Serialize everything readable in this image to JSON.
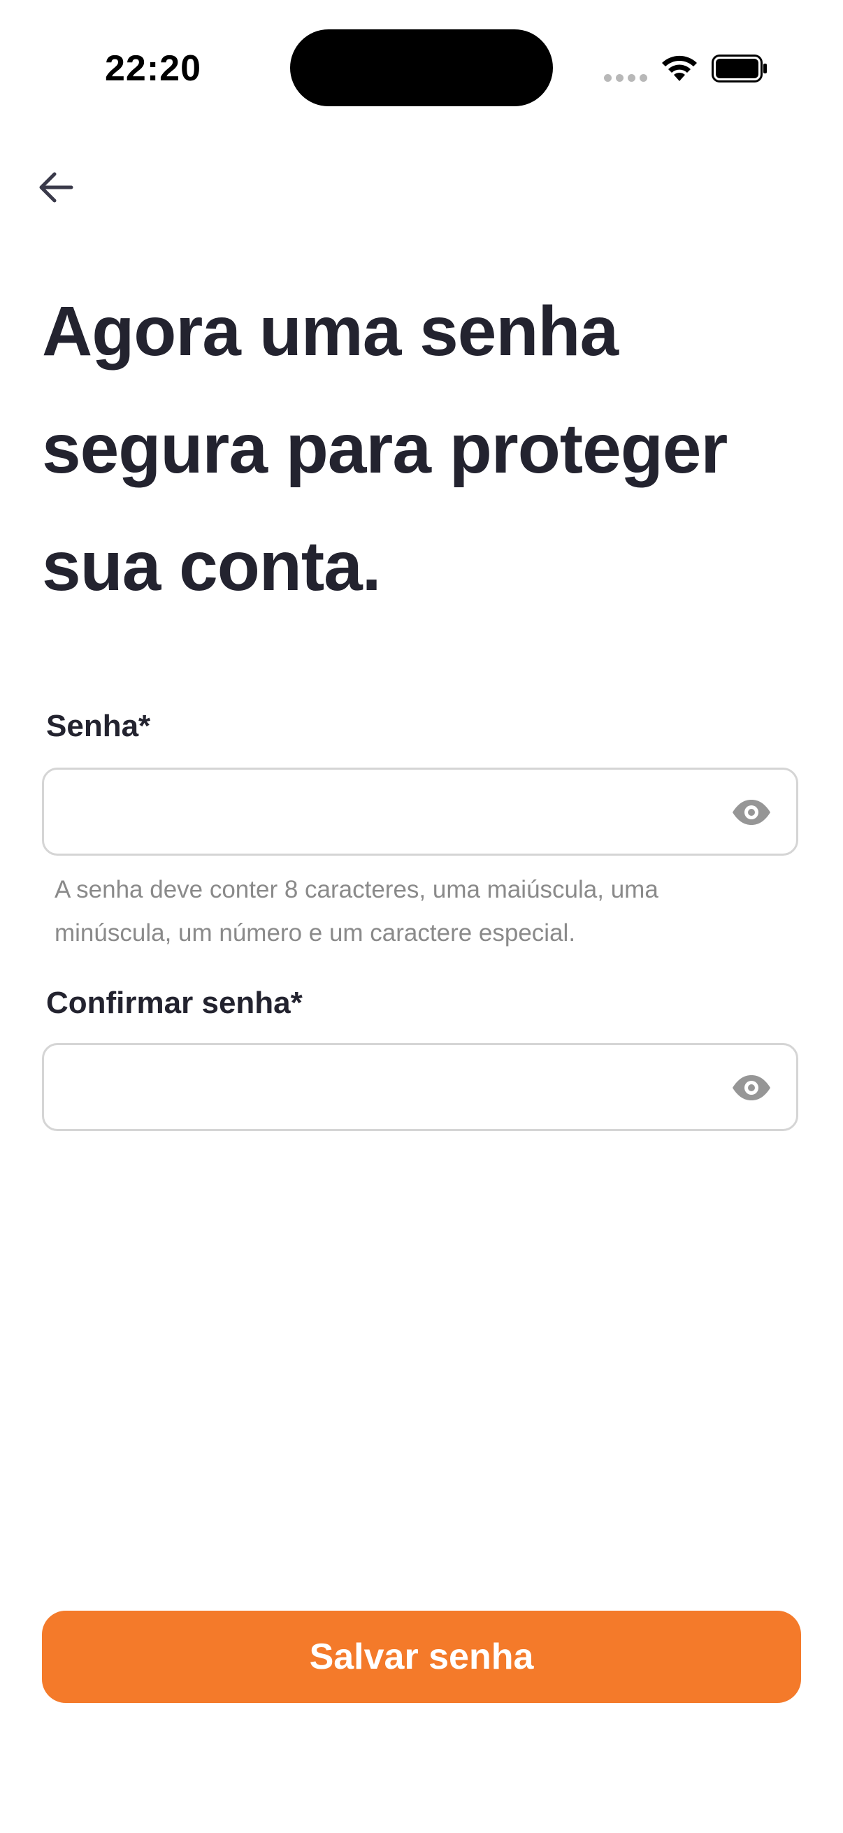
{
  "status_bar": {
    "time": "22:20"
  },
  "navigation": {
    "back_icon": "arrow-left-icon"
  },
  "headline": {
    "lines": [
      "Agora uma senha",
      "segura para proteger",
      "sua conta."
    ]
  },
  "password_field": {
    "label": "Senha*",
    "value": "",
    "placeholder": "",
    "toggle_icon": "eye-icon",
    "hint_lines": [
      "A senha deve conter 8 caracteres, uma maiúscula, uma",
      "minúscula, um número e um caractere especial."
    ]
  },
  "confirm_field": {
    "label": "Confirmar senha*",
    "value": "",
    "placeholder": "",
    "toggle_icon": "eye-icon"
  },
  "actions": {
    "save_label": "Salvar senha"
  },
  "colors": {
    "accent": "#f47a2a",
    "text_primary": "#23232f",
    "text_hint": "#8a8a8a",
    "field_border": "#d5d5d5"
  }
}
